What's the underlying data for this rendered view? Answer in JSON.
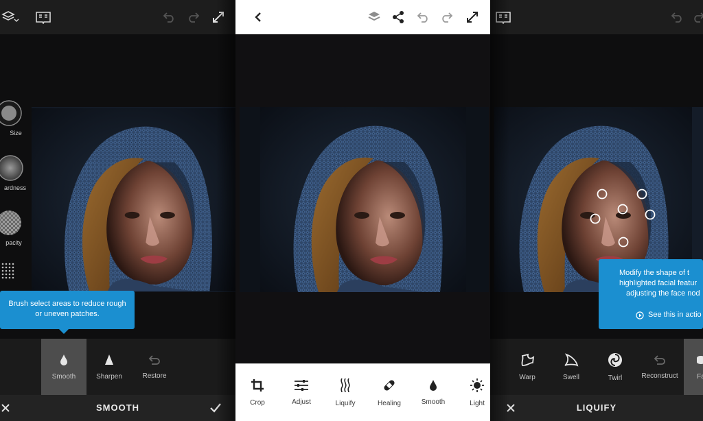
{
  "left_panel": {
    "mode_title": "SMOOTH",
    "controls": [
      {
        "label": "Size"
      },
      {
        "label": "ardness"
      },
      {
        "label": "pacity"
      }
    ],
    "tooltip": {
      "line1": "Brush select areas to reduce rough",
      "line2": "or uneven patches."
    },
    "tools": [
      {
        "label": "Smooth",
        "icon": "drop-icon"
      },
      {
        "label": "Sharpen",
        "icon": "cone-icon"
      },
      {
        "label": "Restore",
        "icon": "undo-arrow-icon"
      }
    ]
  },
  "middle_panel": {
    "tools": [
      {
        "label": "Crop",
        "icon": "crop-icon"
      },
      {
        "label": "Adjust",
        "icon": "sliders-icon"
      },
      {
        "label": "Liquify",
        "icon": "liquify-icon"
      },
      {
        "label": "Healing",
        "icon": "bandage-icon"
      },
      {
        "label": "Smooth",
        "icon": "drop-icon"
      },
      {
        "label": "Light",
        "icon": "sun-icon"
      }
    ]
  },
  "right_panel": {
    "mode_title": "LIQUIFY",
    "tooltip": {
      "line1": "Modify the shape of t",
      "line2": "highlighted facial featur",
      "line3": "adjusting the face nod",
      "link": "See this in actio"
    },
    "tools": [
      {
        "label": "Warp",
        "icon": "warp-icon"
      },
      {
        "label": "Swell",
        "icon": "swell-icon"
      },
      {
        "label": "Twirl",
        "icon": "twirl-icon"
      },
      {
        "label": "Reconstruct",
        "icon": "undo-arrow-icon"
      },
      {
        "label": "Fa",
        "icon": "face-icon"
      }
    ]
  },
  "colors": {
    "accent": "#1b8fd0",
    "dark_bg": "#141414",
    "selected_tool": "#4d4d4d"
  }
}
